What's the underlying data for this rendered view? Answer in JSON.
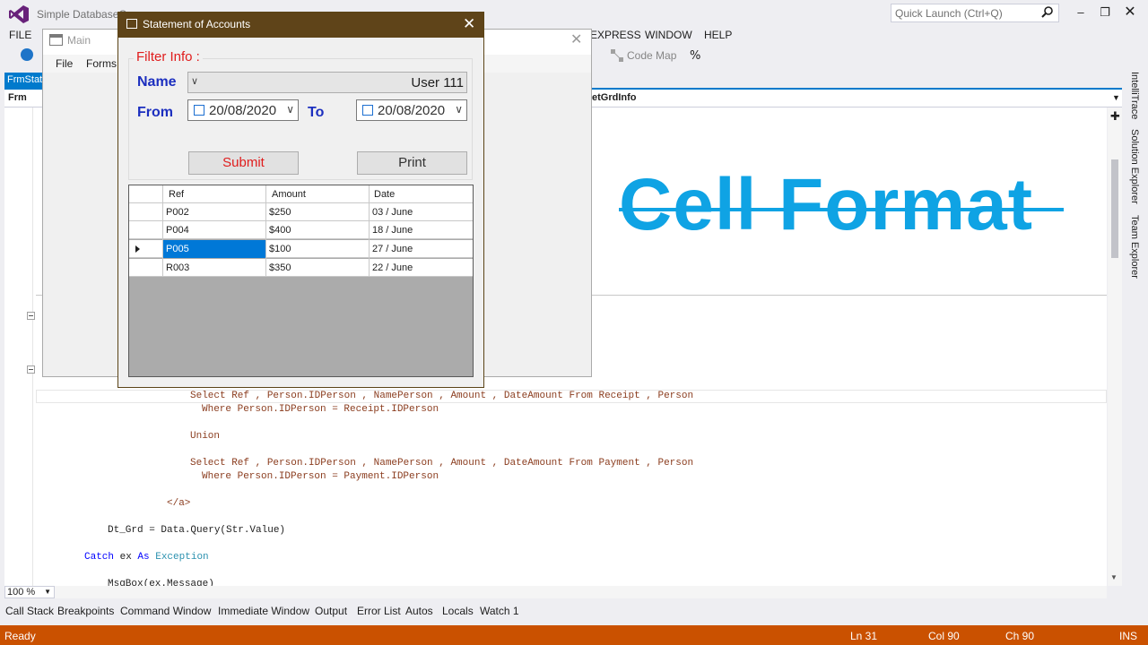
{
  "vs": {
    "title": "Simple DatabaseC",
    "quick_launch_placeholder": "Quick Launch (Ctrl+Q)",
    "menu": [
      "FILE",
      "EXPRESS",
      "WINDOW",
      "HELP"
    ],
    "toolbar_code_map": "Code Map",
    "doc_tab": "FrmStat",
    "nav_left": "Frm",
    "nav_right": "etGrdInfo",
    "zoom": "100 %",
    "side_tabs": [
      "IntelliTrace",
      "Solution Explorer",
      "Team Explorer"
    ],
    "bottom_tabs": [
      "Call Stack",
      "Breakpoints",
      "Command Window",
      "Immediate Window",
      "Output",
      "Error List",
      "Autos",
      "Locals",
      "Watch 1"
    ],
    "status": {
      "left": "Ready",
      "ln": "Ln 31",
      "col": "Col 90",
      "ch": "Ch 90",
      "mode": "INS"
    }
  },
  "banner": {
    "text": "Cell Format",
    "color": "#0fa3e4"
  },
  "code": {
    "line1": "Select Ref , Person.IDPerson , NamePerson , Amount , DateAmount From Receipt , Person",
    "line2": "Where Person.IDPerson = Receipt.IDPerson",
    "line3": "Union",
    "line4": "Select Ref , Person.IDPerson , NamePerson , Amount , DateAmount From Payment , Person",
    "line5": "Where Person.IDPerson = Payment.IDPerson",
    "line6": "</a>",
    "line7": "Dt_Grd = Data.Query(Str.Value)",
    "line8_kw1": "Catch",
    "line8_mid": " ex ",
    "line8_kw2": "As",
    "line8_type": "Exception",
    "line9": "MsgBox(ex.Message)"
  },
  "main_form": {
    "title": "Main",
    "menu": [
      "File",
      "Forms"
    ]
  },
  "dialog": {
    "title": "Statement of Accounts",
    "group_title": "Filter Info :",
    "name_label": "Name",
    "name_value": "User 111",
    "from_label": "From",
    "from_value": "20/08/2020",
    "to_label": "To",
    "to_value": "20/08/2020",
    "submit_label": "Submit",
    "print_label": "Print",
    "colors": {
      "titlebar": "#5f4419",
      "label": "#1c2fbf",
      "group_title": "#e01c1c",
      "selection": "#0078d7"
    }
  },
  "grid": {
    "columns": [
      "Ref",
      "Amount",
      "Date"
    ],
    "rows": [
      {
        "ref": "P002",
        "amount": "$250",
        "date": "03 / June"
      },
      {
        "ref": "P004",
        "amount": "$400",
        "date": "18 / June"
      },
      {
        "ref": "P005",
        "amount": "$100",
        "date": "27 / June"
      },
      {
        "ref": "R003",
        "amount": "$350",
        "date": "22 / June"
      }
    ],
    "selected_row": 2
  }
}
